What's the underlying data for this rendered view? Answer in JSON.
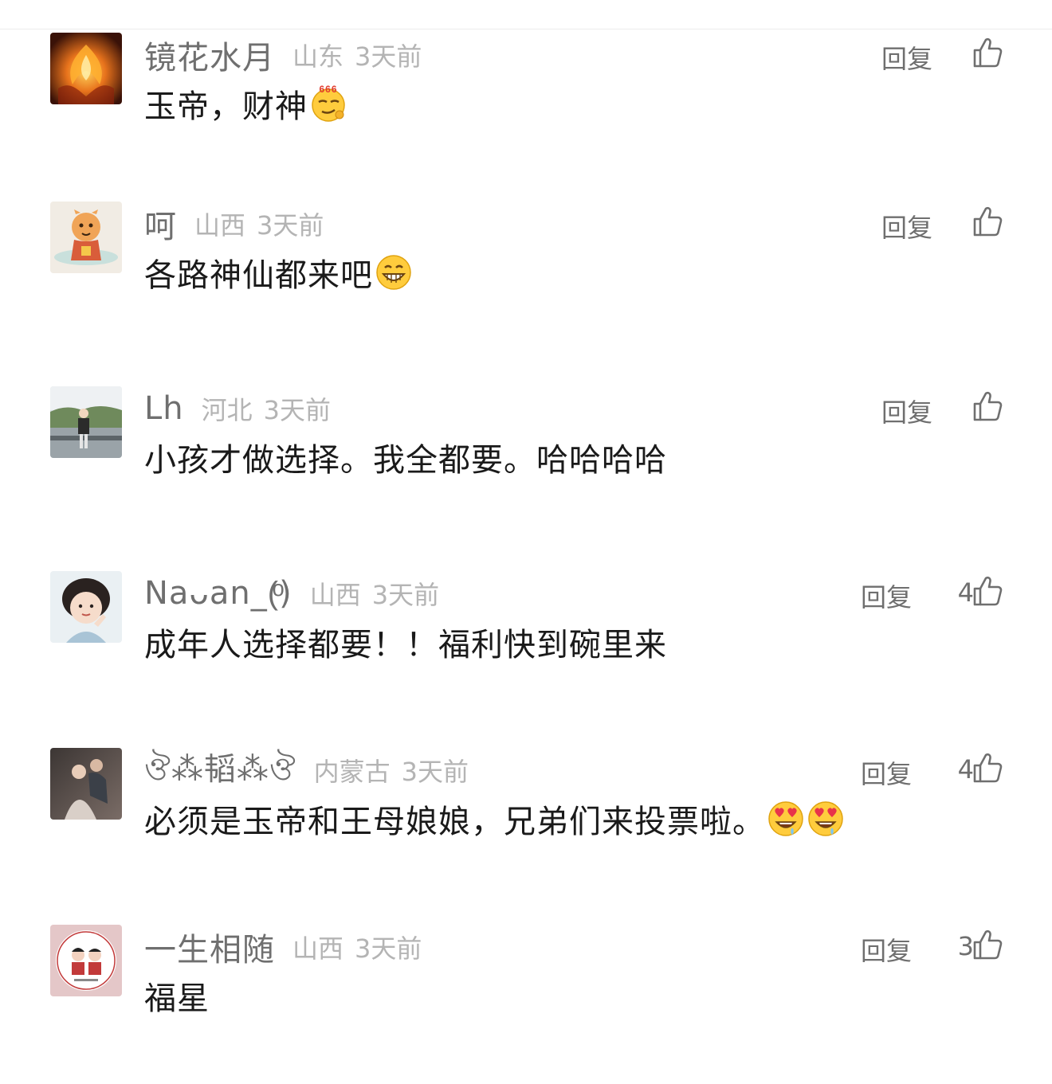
{
  "reply_label": "回复",
  "icons": {
    "like": "thumbs-up-icon"
  },
  "comments": [
    {
      "username": "镜花水月",
      "location": "山东",
      "time": "3天前",
      "text": "玉帝，财神",
      "emoji": [
        "666-smug-emoji"
      ],
      "likes": ""
    },
    {
      "username": "呵",
      "location": "山西",
      "time": "3天前",
      "text": "各路神仙都来吧",
      "emoji": [
        "grin-emoji"
      ],
      "likes": ""
    },
    {
      "username": "Lh",
      "location": "河北",
      "time": "3天前",
      "text": "小孩才做选择。我全都要。哈哈哈哈",
      "emoji": [],
      "likes": ""
    },
    {
      "username": "Naᴗan_(ͦ)",
      "location": "山西",
      "time": "3天前",
      "text": "成年人选择都要！！福利快到碗里来",
      "emoji": [],
      "likes": "4"
    },
    {
      "username": "ঔ⁂韬⁂ঔ",
      "location": "内蒙古",
      "time": "3天前",
      "text": "必须是玉帝和王母娘娘，兄弟们来投票啦。",
      "emoji": [
        "heart-eyes-emoji",
        "heart-eyes-emoji"
      ],
      "likes": "4"
    },
    {
      "username": "一生相随",
      "location": "山西",
      "time": "3天前",
      "text": "福星",
      "emoji": [],
      "likes": "3"
    }
  ]
}
